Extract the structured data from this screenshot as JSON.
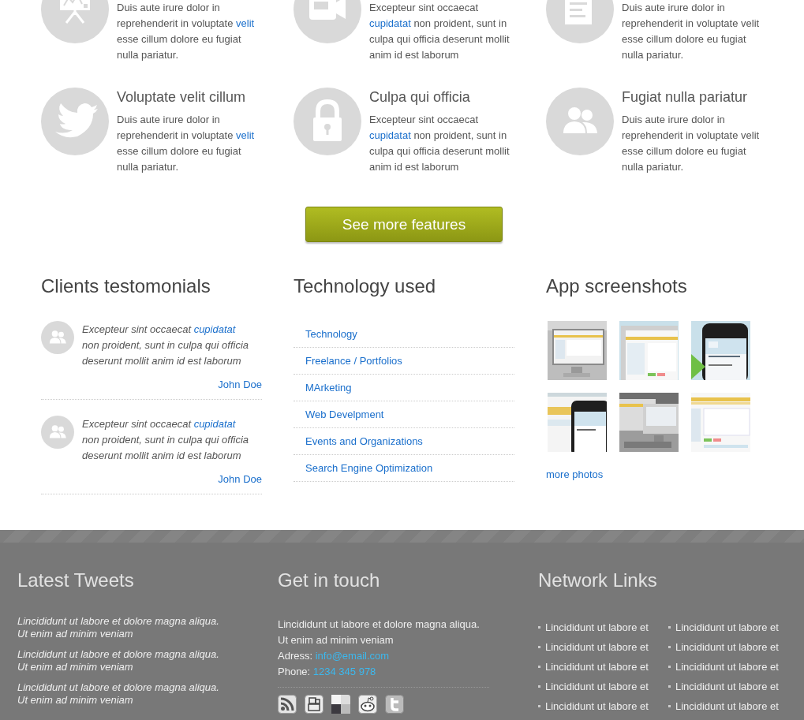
{
  "features": [
    {
      "body": [
        {
          "text": "Duis aute irure dolor in reprehenderit in voluptate "
        },
        {
          "text": "velit",
          "link": true
        },
        {
          "text": " esse cillum dolore eu fugiat nulla pariatur."
        }
      ]
    },
    {
      "body": [
        {
          "text": "Excepteur sint occaecat "
        },
        {
          "text": "cupidatat",
          "link": true
        },
        {
          "text": " non proident, sunt in culpa qui officia deserunt mollit anim id est laborum"
        }
      ]
    },
    {
      "body": [
        {
          "text": "Duis aute irure dolor in reprehenderit in voluptate velit esse cillum dolore eu fugiat nulla pariatur."
        }
      ]
    },
    {
      "title": "Voluptate velit cillum",
      "body": [
        {
          "text": "Duis aute irure dolor in reprehenderit in voluptate "
        },
        {
          "text": "velit",
          "link": true
        },
        {
          "text": " esse cillum dolore eu fugiat nulla pariatur."
        }
      ]
    },
    {
      "title": "Culpa qui officia",
      "body": [
        {
          "text": "Excepteur sint occaecat "
        },
        {
          "text": "cupidatat",
          "link": true
        },
        {
          "text": " non proident, sunt in culpa qui officia deserunt mollit anim id est laborum"
        }
      ]
    },
    {
      "title": "Fugiat nulla pariatur",
      "body": [
        {
          "text": "Duis aute irure dolor in reprehenderit in voluptate velit esse cillum dolore eu fugiat nulla pariatur."
        }
      ]
    }
  ],
  "more_button": "See more features",
  "testimonials": {
    "title": "Clients testomonials",
    "items": [
      {
        "quote": [
          {
            "text": "Excepteur sint occaecat "
          },
          {
            "text": "cupidatat",
            "link": true
          },
          {
            "text": " non proident, sunt in culpa qui officia deserunt mollit anim id est laborum"
          }
        ],
        "author": "John Doe"
      },
      {
        "quote": [
          {
            "text": "Excepteur sint occaecat "
          },
          {
            "text": "cupidatat",
            "link": true
          },
          {
            "text": " non proident, sunt in culpa qui officia deserunt mollit anim id est laborum"
          }
        ],
        "author": "John Doe"
      }
    ]
  },
  "technology": {
    "title": "Technology used",
    "items": [
      "Technology",
      "Freelance / Portfolios",
      "MArketing",
      "Web Develpment",
      "Events and Organizations",
      "Search Engine Optimization"
    ]
  },
  "screenshots": {
    "title": "App screenshots",
    "more_link": "more photos"
  },
  "footer": {
    "tweets": {
      "title": "Latest Tweets",
      "items": [
        "Lincididunt ut labore et dolore magna aliqua. Ut enim ad minim veniam",
        "Lincididunt ut labore et dolore magna aliqua. Ut enim ad minim veniam",
        "Lincididunt ut labore et dolore magna aliqua. Ut enim ad minim veniam"
      ]
    },
    "contact": {
      "title": "Get in touch",
      "lines": [
        "Lincididunt ut labore et dolore magna aliqua.",
        "Ut enim ad minim veniam"
      ],
      "address_label": "Adress:",
      "email": "info@email.com",
      "phone_label": "Phone:",
      "phone": "1234 345 978"
    },
    "network": {
      "title": "Network Links",
      "links": [
        "Lincididunt ut labore et",
        "Lincididunt ut labore et",
        "Lincididunt ut labore et",
        "Lincididunt ut labore et",
        "Lincididunt ut labore et",
        "Lincididunt ut labore et",
        "Lincididunt ut labore et",
        "Lincididunt ut labore et",
        "Lincididunt ut labore et",
        "Lincididunt ut labore et"
      ]
    }
  }
}
